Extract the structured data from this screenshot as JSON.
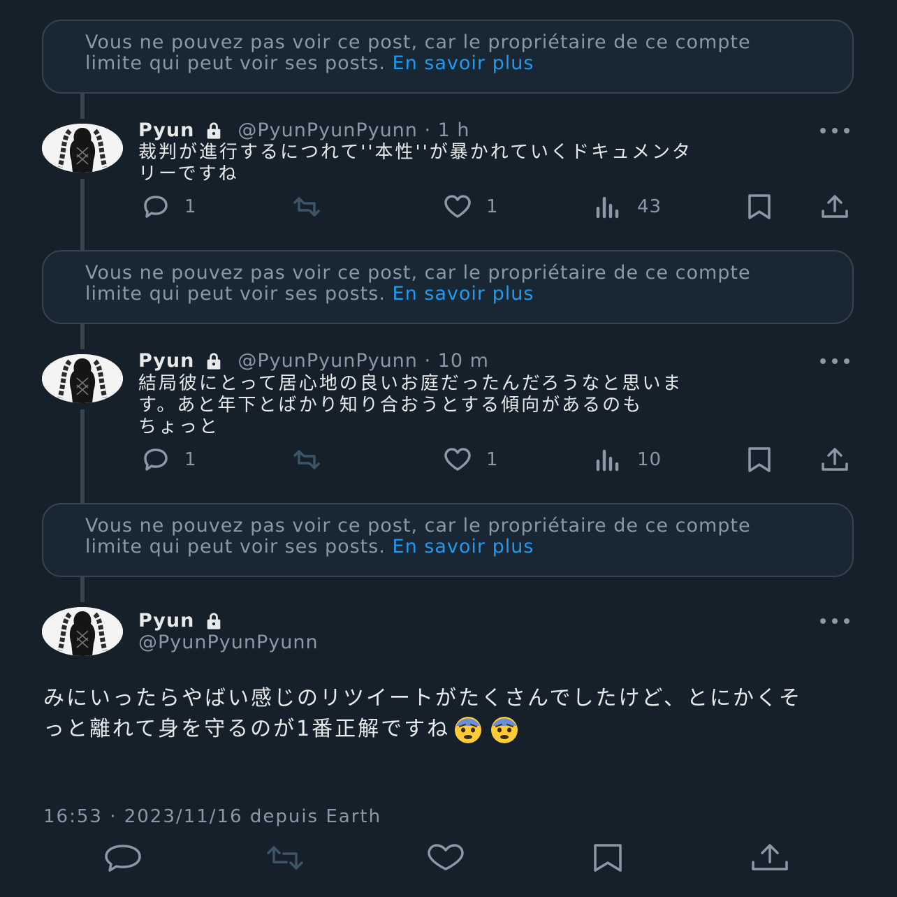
{
  "notice": {
    "text": "Vous ne pouvez pas voir ce post, car le propriétaire de ce compte limite qui peut voir ses posts.",
    "link": "En savoir plus"
  },
  "replies": [
    {
      "name": "Pyun",
      "handle": "@PyunPyunPyunn · 1 h",
      "text": "裁判が進行するにつれて''本性''が暴かれていくドキュメンタ\nリーですね",
      "replies": "1",
      "likes": "1",
      "views": "43"
    },
    {
      "name": "Pyun",
      "handle": "@PyunPyunPyunn · 10 m",
      "text": "結局彼にとって居心地の良いお庭だったんだろうなと思いま\nす。あと年下とばかり知り合おうとする傾向があるのも\nちょっと",
      "replies": "1",
      "likes": "1",
      "views": "10"
    }
  ],
  "main": {
    "name": "Pyun",
    "handle": "@PyunPyunPyunn",
    "text_part1": "みにいったらやばい感じのリツイートがたくさんでしたけど、とにかくそっと離れて身を守るのが1番正解ですね",
    "emoji": "😨",
    "timestamp": "16:53 · 2023/11/16 depuis Earth"
  },
  "icons": {
    "lock": "lock-icon",
    "more": "more-icon",
    "reply": "reply-icon",
    "retweet": "retweet-icon",
    "like": "like-icon",
    "views": "views-icon",
    "bookmark": "bookmark-icon",
    "share": "share-icon"
  },
  "colors": {
    "background": "#15202b",
    "link": "#1d9bf0",
    "muted": "#8b98a5",
    "retweet_disabled": "#3d5466"
  }
}
